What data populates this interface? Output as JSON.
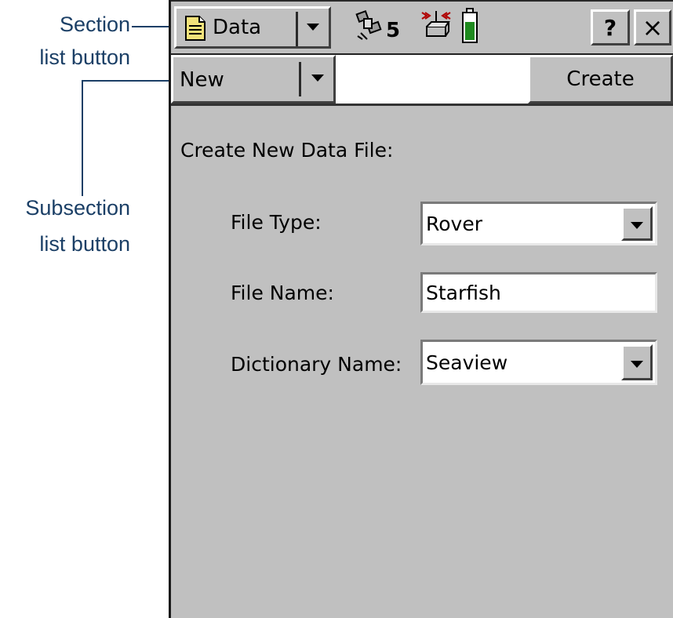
{
  "callouts": {
    "section_line1": "Section",
    "section_line2": "list button",
    "subsection_line1": "Subsection",
    "subsection_line2": "list button"
  },
  "titlebar": {
    "section_label": "Data",
    "satellite_count": "5",
    "help_label": "?",
    "close_label": "×"
  },
  "toolbar": {
    "subsection_label": "New",
    "create_label": "Create"
  },
  "form": {
    "heading": "Create New Data File:",
    "file_type_label": "File Type:",
    "file_type_value": "Rover",
    "file_name_label": "File Name:",
    "file_name_value": "Starfish",
    "dictionary_label": "Dictionary Name:",
    "dictionary_value": "Seaview"
  },
  "icons": {
    "section": "document-icon",
    "satellite": "satellite-icon",
    "receiver": "receiver-signal-icon",
    "battery": "battery-icon"
  },
  "colors": {
    "callout_text": "#1b3f66",
    "panel_gray": "#c0c0c0",
    "battery_fill": "#1e8a1e",
    "document_icon": "#f3e27a"
  }
}
